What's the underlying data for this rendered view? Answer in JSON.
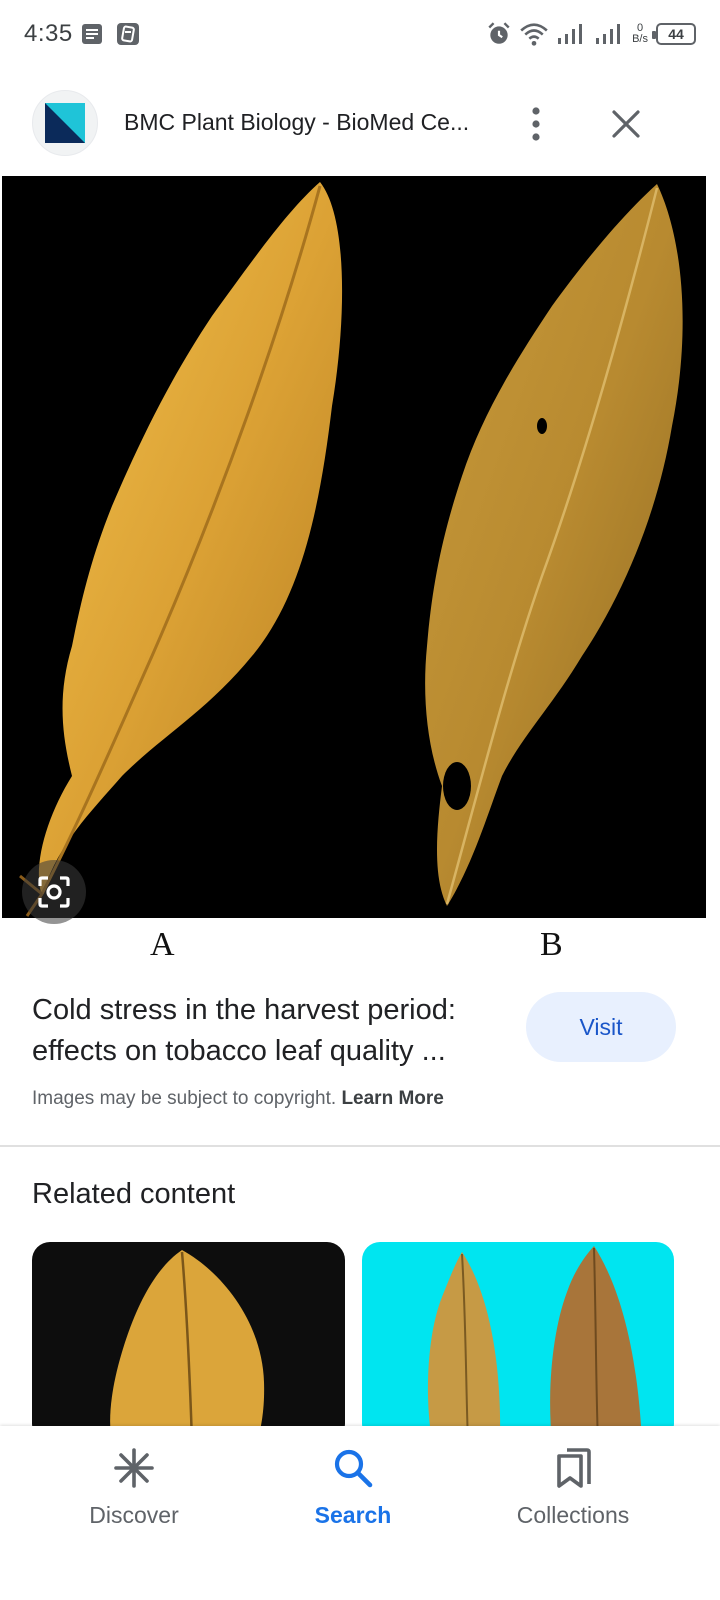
{
  "status_bar": {
    "time": "4:35",
    "net_speed_value": "0",
    "net_speed_unit": "B/s",
    "battery": "44"
  },
  "header": {
    "title": "BMC Plant Biology - BioMed Ce...",
    "logo_icon": "bmc-logo-icon",
    "more_icon": "more-vert-icon",
    "close_icon": "close-icon"
  },
  "image": {
    "label_a": "A",
    "label_b": "B",
    "lens_icon": "google-lens-icon"
  },
  "result": {
    "title": "Cold stress in the harvest period: effects on tobacco leaf quality ...",
    "visit_label": "Visit",
    "copyright_text": "Images may be subject to copyright.",
    "learn_more": "Learn More"
  },
  "related": {
    "heading": "Related content"
  },
  "bottom_nav": {
    "items": [
      {
        "label": "Discover",
        "icon": "asterisk-icon",
        "active": false
      },
      {
        "label": "Search",
        "icon": "search-icon",
        "active": true
      },
      {
        "label": "Collections",
        "icon": "bookmarks-icon",
        "active": false
      }
    ]
  },
  "colors": {
    "accent": "#1a73e8",
    "visit_bg": "#e8f0fe",
    "visit_text": "#1a56c9",
    "leaf_a": "#d9a233",
    "leaf_b": "#b58a2c",
    "related_card_2_bg": "#00e5f0"
  }
}
